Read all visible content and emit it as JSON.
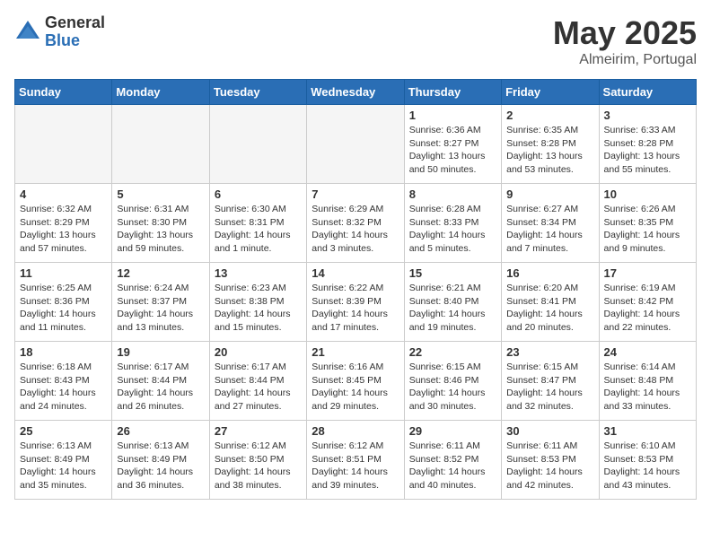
{
  "logo": {
    "general": "General",
    "blue": "Blue"
  },
  "title": {
    "month": "May 2025",
    "location": "Almeirim, Portugal"
  },
  "weekdays": [
    "Sunday",
    "Monday",
    "Tuesday",
    "Wednesday",
    "Thursday",
    "Friday",
    "Saturday"
  ],
  "weeks": [
    [
      {
        "day": "",
        "info": ""
      },
      {
        "day": "",
        "info": ""
      },
      {
        "day": "",
        "info": ""
      },
      {
        "day": "",
        "info": ""
      },
      {
        "day": "1",
        "info": "Sunrise: 6:36 AM\nSunset: 8:27 PM\nDaylight: 13 hours\nand 50 minutes."
      },
      {
        "day": "2",
        "info": "Sunrise: 6:35 AM\nSunset: 8:28 PM\nDaylight: 13 hours\nand 53 minutes."
      },
      {
        "day": "3",
        "info": "Sunrise: 6:33 AM\nSunset: 8:28 PM\nDaylight: 13 hours\nand 55 minutes."
      }
    ],
    [
      {
        "day": "4",
        "info": "Sunrise: 6:32 AM\nSunset: 8:29 PM\nDaylight: 13 hours\nand 57 minutes."
      },
      {
        "day": "5",
        "info": "Sunrise: 6:31 AM\nSunset: 8:30 PM\nDaylight: 13 hours\nand 59 minutes."
      },
      {
        "day": "6",
        "info": "Sunrise: 6:30 AM\nSunset: 8:31 PM\nDaylight: 14 hours\nand 1 minute."
      },
      {
        "day": "7",
        "info": "Sunrise: 6:29 AM\nSunset: 8:32 PM\nDaylight: 14 hours\nand 3 minutes."
      },
      {
        "day": "8",
        "info": "Sunrise: 6:28 AM\nSunset: 8:33 PM\nDaylight: 14 hours\nand 5 minutes."
      },
      {
        "day": "9",
        "info": "Sunrise: 6:27 AM\nSunset: 8:34 PM\nDaylight: 14 hours\nand 7 minutes."
      },
      {
        "day": "10",
        "info": "Sunrise: 6:26 AM\nSunset: 8:35 PM\nDaylight: 14 hours\nand 9 minutes."
      }
    ],
    [
      {
        "day": "11",
        "info": "Sunrise: 6:25 AM\nSunset: 8:36 PM\nDaylight: 14 hours\nand 11 minutes."
      },
      {
        "day": "12",
        "info": "Sunrise: 6:24 AM\nSunset: 8:37 PM\nDaylight: 14 hours\nand 13 minutes."
      },
      {
        "day": "13",
        "info": "Sunrise: 6:23 AM\nSunset: 8:38 PM\nDaylight: 14 hours\nand 15 minutes."
      },
      {
        "day": "14",
        "info": "Sunrise: 6:22 AM\nSunset: 8:39 PM\nDaylight: 14 hours\nand 17 minutes."
      },
      {
        "day": "15",
        "info": "Sunrise: 6:21 AM\nSunset: 8:40 PM\nDaylight: 14 hours\nand 19 minutes."
      },
      {
        "day": "16",
        "info": "Sunrise: 6:20 AM\nSunset: 8:41 PM\nDaylight: 14 hours\nand 20 minutes."
      },
      {
        "day": "17",
        "info": "Sunrise: 6:19 AM\nSunset: 8:42 PM\nDaylight: 14 hours\nand 22 minutes."
      }
    ],
    [
      {
        "day": "18",
        "info": "Sunrise: 6:18 AM\nSunset: 8:43 PM\nDaylight: 14 hours\nand 24 minutes."
      },
      {
        "day": "19",
        "info": "Sunrise: 6:17 AM\nSunset: 8:44 PM\nDaylight: 14 hours\nand 26 minutes."
      },
      {
        "day": "20",
        "info": "Sunrise: 6:17 AM\nSunset: 8:44 PM\nDaylight: 14 hours\nand 27 minutes."
      },
      {
        "day": "21",
        "info": "Sunrise: 6:16 AM\nSunset: 8:45 PM\nDaylight: 14 hours\nand 29 minutes."
      },
      {
        "day": "22",
        "info": "Sunrise: 6:15 AM\nSunset: 8:46 PM\nDaylight: 14 hours\nand 30 minutes."
      },
      {
        "day": "23",
        "info": "Sunrise: 6:15 AM\nSunset: 8:47 PM\nDaylight: 14 hours\nand 32 minutes."
      },
      {
        "day": "24",
        "info": "Sunrise: 6:14 AM\nSunset: 8:48 PM\nDaylight: 14 hours\nand 33 minutes."
      }
    ],
    [
      {
        "day": "25",
        "info": "Sunrise: 6:13 AM\nSunset: 8:49 PM\nDaylight: 14 hours\nand 35 minutes."
      },
      {
        "day": "26",
        "info": "Sunrise: 6:13 AM\nSunset: 8:49 PM\nDaylight: 14 hours\nand 36 minutes."
      },
      {
        "day": "27",
        "info": "Sunrise: 6:12 AM\nSunset: 8:50 PM\nDaylight: 14 hours\nand 38 minutes."
      },
      {
        "day": "28",
        "info": "Sunrise: 6:12 AM\nSunset: 8:51 PM\nDaylight: 14 hours\nand 39 minutes."
      },
      {
        "day": "29",
        "info": "Sunrise: 6:11 AM\nSunset: 8:52 PM\nDaylight: 14 hours\nand 40 minutes."
      },
      {
        "day": "30",
        "info": "Sunrise: 6:11 AM\nSunset: 8:53 PM\nDaylight: 14 hours\nand 42 minutes."
      },
      {
        "day": "31",
        "info": "Sunrise: 6:10 AM\nSunset: 8:53 PM\nDaylight: 14 hours\nand 43 minutes."
      }
    ]
  ]
}
